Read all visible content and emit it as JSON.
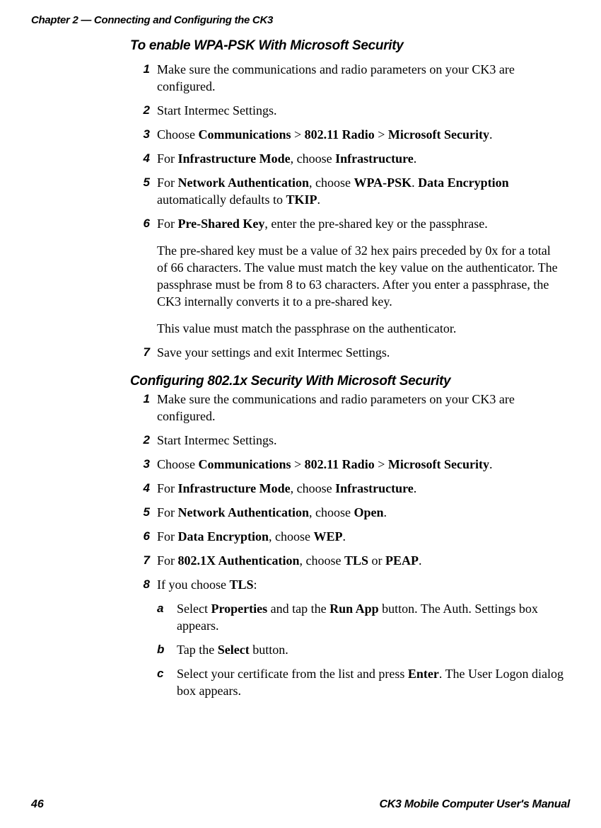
{
  "chapter_header": "Chapter 2 — Connecting and Configuring the CK3",
  "section1": {
    "heading": "To enable WPA-PSK With Microsoft Security",
    "steps": {
      "s1": {
        "num": "1",
        "text": "Make sure the communications and radio parameters on your CK3 are configured."
      },
      "s2": {
        "num": "2",
        "text": "Start Intermec Settings."
      },
      "s3": {
        "num": "3",
        "pre": "Choose ",
        "b1": "Communications",
        "gt1": " > ",
        "b2": "802.11 Radio",
        "gt2": " > ",
        "b3": "Microsoft Security",
        "post": "."
      },
      "s4": {
        "num": "4",
        "pre": "For ",
        "b1": "Infrastructure Mode",
        "mid": ", choose ",
        "b2": "Infrastructure",
        "post": "."
      },
      "s5": {
        "num": "5",
        "pre": "For ",
        "b1": "Network Authentication",
        "mid1": ", choose ",
        "b2": "WPA-PSK",
        "mid2": ". ",
        "b3": "Data Encryption",
        "mid3": " automatically defaults to ",
        "b4": "TKIP",
        "post": "."
      },
      "s6": {
        "num": "6",
        "p1_pre": "For ",
        "p1_b": "Pre-Shared Key",
        "p1_post": ", enter the pre-shared key or the passphrase.",
        "p2": "The pre-shared key must be a value of 32 hex pairs preceded by 0x for a total of 66 characters. The value must match the key value on the authenticator. The passphrase must be from 8 to 63 characters. After you enter a passphrase, the CK3 internally converts it to a pre-shared key.",
        "p3": "This value must match the passphrase on the authenticator."
      },
      "s7": {
        "num": "7",
        "text": "Save your settings and exit Intermec Settings."
      }
    }
  },
  "section2": {
    "heading": "Configuring 802.1x Security With Microsoft Security",
    "steps": {
      "s1": {
        "num": "1",
        "text": "Make sure the communications and radio parameters on your CK3 are configured."
      },
      "s2": {
        "num": "2",
        "text": "Start Intermec Settings."
      },
      "s3": {
        "num": "3",
        "pre": "Choose ",
        "b1": "Communications",
        "gt1": " > ",
        "b2": "802.11 Radio",
        "gt2": " > ",
        "b3": "Microsoft Security",
        "post": "."
      },
      "s4": {
        "num": "4",
        "pre": "For ",
        "b1": "Infrastructure Mode",
        "mid": ", choose ",
        "b2": "Infrastructure",
        "post": "."
      },
      "s5": {
        "num": "5",
        "pre": "For ",
        "b1": "Network Authentication",
        "mid": ", choose ",
        "b2": "Open",
        "post": "."
      },
      "s6": {
        "num": "6",
        "pre": "For ",
        "b1": "Data Encryption",
        "mid": ", choose ",
        "b2": "WEP",
        "post": "."
      },
      "s7": {
        "num": "7",
        "pre": "For ",
        "b1": "802.1X Authentication",
        "mid": ", choose ",
        "b2": "TLS",
        "or": " or ",
        "b3": "PEAP",
        "post": "."
      },
      "s8": {
        "num": "8",
        "pre": "If you choose ",
        "b1": "TLS",
        "post": ":",
        "a": {
          "mark": "a",
          "pre": "Select ",
          "b1": "Properties",
          "mid": " and tap the ",
          "b2": "Run App",
          "post": " button. The Auth. Settings box appears."
        },
        "b": {
          "mark": "b",
          "pre": "Tap the ",
          "b1": "Select",
          "post": " button."
        },
        "c": {
          "mark": "c",
          "pre": "Select your certificate from the list and press ",
          "b1": "Enter",
          "post": ". The User Logon dialog box appears."
        }
      }
    }
  },
  "footer": {
    "page": "46",
    "title": "CK3 Mobile Computer User's Manual"
  }
}
